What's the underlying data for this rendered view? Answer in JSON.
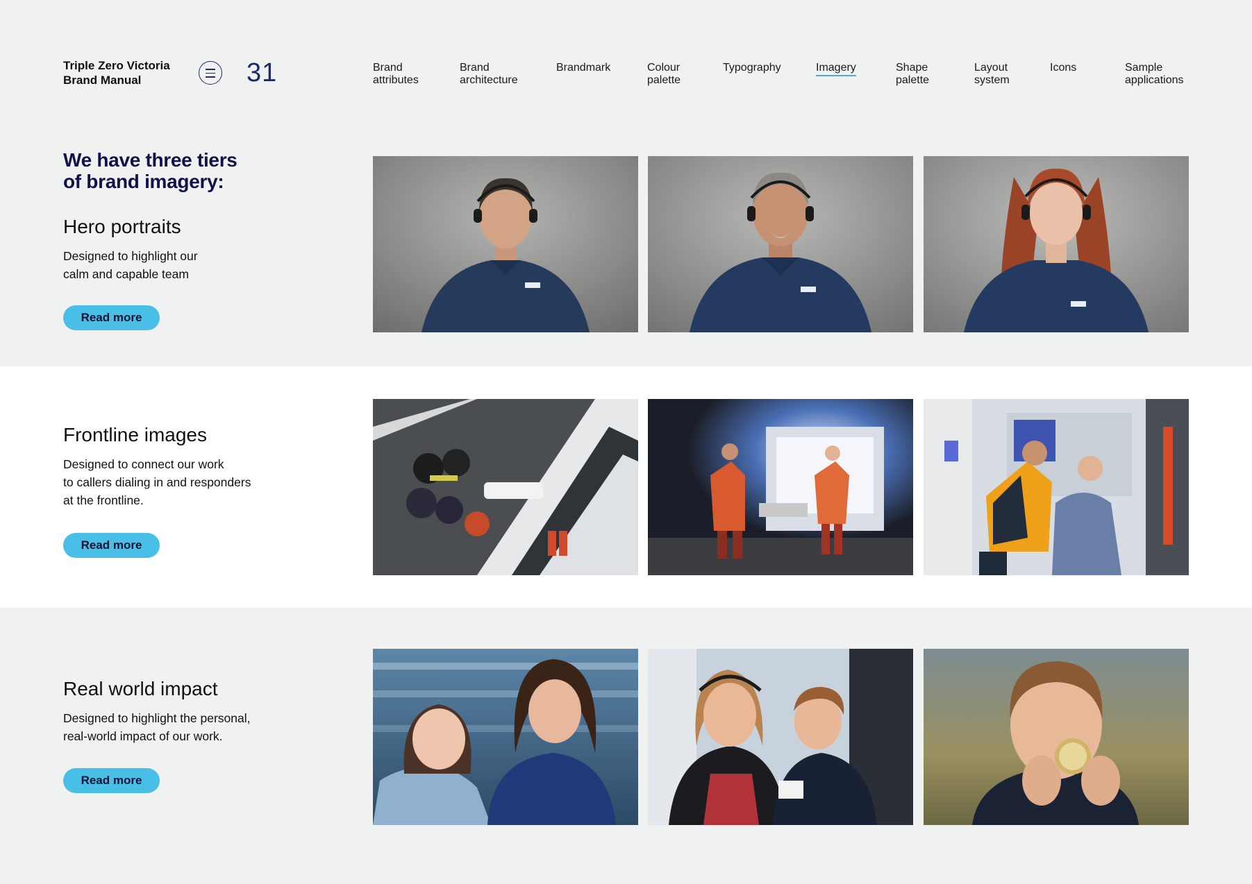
{
  "header": {
    "brand_line1": "Triple Zero Victoria",
    "brand_line2": "Brand Manual",
    "page_number": "31",
    "menu_icon": "hamburger-menu-icon"
  },
  "nav": {
    "active": "Imagery",
    "items": [
      {
        "label": "Brand\nattributes"
      },
      {
        "label": "Brand\narchitecture"
      },
      {
        "label": "Brandmark"
      },
      {
        "label": "Colour\npalette"
      },
      {
        "label": "Typography"
      },
      {
        "label": "Imagery"
      },
      {
        "label": "Shape\npalette"
      },
      {
        "label": "Layout\nsystem"
      },
      {
        "label": "Icons"
      },
      {
        "label": "Sample\napplications"
      }
    ]
  },
  "intro": {
    "title": "We have three tiers\nof brand imagery:"
  },
  "sections": [
    {
      "title": "Hero portraits",
      "description": "Designed to highlight our\ncalm and capable team",
      "button": "Read more"
    },
    {
      "title": "Frontline images",
      "description": "Designed to connect our work\nto callers dialing in and responders\nat the frontline.",
      "button": "Read more"
    },
    {
      "title": "Real world impact",
      "description": "Designed to highlight the personal,\nreal-world impact of our work.",
      "button": "Read more"
    }
  ],
  "colors": {
    "background": "#f0f1f1",
    "white_band": "#ffffff",
    "navy": "#11124a",
    "button": "#49bfe8",
    "active_underline": "#4fa8d8"
  }
}
